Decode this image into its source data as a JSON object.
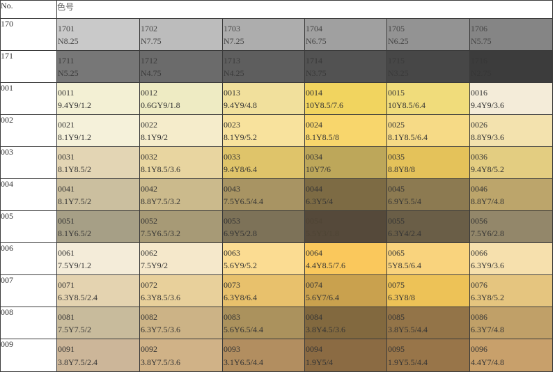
{
  "header": {
    "no_label": "No.",
    "title": "色号"
  },
  "rows": [
    {
      "no": "170",
      "cells": [
        {
          "code": "1701",
          "munsell": "N8.25",
          "color": "#c9c9c9",
          "text": "#444444"
        },
        {
          "code": "1702",
          "munsell": "N7.75",
          "color": "#bcbcbc",
          "text": "#444444"
        },
        {
          "code": "1703",
          "munsell": "N7.25",
          "color": "#adadad",
          "text": "#444444"
        },
        {
          "code": "1704",
          "munsell": "N6.75",
          "color": "#a0a0a0",
          "text": "#444444"
        },
        {
          "code": "1705",
          "munsell": "N6.25",
          "color": "#939393",
          "text": "#444444"
        },
        {
          "code": "1706",
          "munsell": "N5.75",
          "color": "#858585",
          "text": "#444444"
        }
      ]
    },
    {
      "no": "171",
      "cells": [
        {
          "code": "1711",
          "munsell": "N5.25",
          "color": "#777777",
          "text": "#3a3a3a"
        },
        {
          "code": "1712",
          "munsell": "N4.75",
          "color": "#6b6b6b",
          "text": "#3a3a3a"
        },
        {
          "code": "1713",
          "munsell": "N4.25",
          "color": "#5e5e5e",
          "text": "#3a3a3a"
        },
        {
          "code": "1714",
          "munsell": "N3.75",
          "color": "#525252",
          "text": "#383838"
        },
        {
          "code": "1715",
          "munsell": "N3.25",
          "color": "#474747",
          "text": "#3a3a3a"
        },
        {
          "code": "1716",
          "munsell": "N2.75",
          "color": "#3c3c3c",
          "text": "#363636"
        }
      ]
    },
    {
      "no": "001",
      "cells": [
        {
          "code": "0011",
          "munsell": "9.4Y9/1.2",
          "color": "#f3f0d4",
          "text": "#333333"
        },
        {
          "code": "0012",
          "munsell": "0.6GY9/1.8",
          "color": "#eeebc3",
          "text": "#333333"
        },
        {
          "code": "0013",
          "munsell": "9.4Y9/4.8",
          "color": "#f1e09c",
          "text": "#333333"
        },
        {
          "code": "0014",
          "munsell": "10Y8.5/7.6",
          "color": "#f1d45f",
          "text": "#333333"
        },
        {
          "code": "0015",
          "munsell": "10Y8.5/6.4",
          "color": "#f0dc7b",
          "text": "#333333"
        },
        {
          "code": "0016",
          "munsell": "9.4Y9/3.6",
          "color": "#f4ecd9",
          "text": "#333333"
        }
      ]
    },
    {
      "no": "002",
      "cells": [
        {
          "code": "0021",
          "munsell": "8.1Y9/1.2",
          "color": "#f5f1da",
          "text": "#333333"
        },
        {
          "code": "0022",
          "munsell": "8.1Y9/2",
          "color": "#f5eccb",
          "text": "#333333"
        },
        {
          "code": "0023",
          "munsell": "8.1Y9/5.2",
          "color": "#f8e29d",
          "text": "#333333"
        },
        {
          "code": "0024",
          "munsell": "8.1Y8.5/8",
          "color": "#f8d66c",
          "text": "#333333"
        },
        {
          "code": "0025",
          "munsell": "8.1Y8.5/6.4",
          "color": "#f6da86",
          "text": "#333333"
        },
        {
          "code": "0026",
          "munsell": "8.8Y9/3.6",
          "color": "#f3e2ae",
          "text": "#333333"
        }
      ]
    },
    {
      "no": "003",
      "cells": [
        {
          "code": "0031",
          "munsell": "8.1Y8.5/2",
          "color": "#e3d5b4",
          "text": "#333333"
        },
        {
          "code": "0032",
          "munsell": "8.1Y8.5/3.6",
          "color": "#e8d5a0",
          "text": "#333333"
        },
        {
          "code": "0033",
          "munsell": "9.4Y8/6.4",
          "color": "#dfc46a",
          "text": "#333333"
        },
        {
          "code": "0034",
          "munsell": "10Y7/6",
          "color": "#bda75a",
          "text": "#333333"
        },
        {
          "code": "0035",
          "munsell": "8.8Y8/8",
          "color": "#e4c25a",
          "text": "#333333"
        },
        {
          "code": "0036",
          "munsell": "9.4Y8/5.2",
          "color": "#e3cd81",
          "text": "#333333"
        }
      ]
    },
    {
      "no": "004",
      "cells": [
        {
          "code": "0041",
          "munsell": "8.1Y7.5/2",
          "color": "#cbbf9f",
          "text": "#333333"
        },
        {
          "code": "0042",
          "munsell": "8.8Y7.5/3.2",
          "color": "#cbba8c",
          "text": "#333333"
        },
        {
          "code": "0043",
          "munsell": "7.5Y6.5/4.4",
          "color": "#a89463",
          "text": "#333333"
        },
        {
          "code": "0044",
          "munsell": "6.3Y5/4",
          "color": "#7d6b44",
          "text": "#333333"
        },
        {
          "code": "0045",
          "munsell": "6.9Y5.5/4",
          "color": "#8c7a51",
          "text": "#333333"
        },
        {
          "code": "0046",
          "munsell": "8.8Y7/4.8",
          "color": "#bca56b",
          "text": "#333333"
        }
      ]
    },
    {
      "no": "005",
      "cells": [
        {
          "code": "0051",
          "munsell": "8.1Y6.5/2",
          "color": "#a69f86",
          "text": "#333333"
        },
        {
          "code": "0052",
          "munsell": "7.5Y6.5/3.2",
          "color": "#a79a76",
          "text": "#333333"
        },
        {
          "code": "0053",
          "munsell": "6.9Y5/2.8",
          "color": "#7d7258",
          "text": "#333333"
        },
        {
          "code": "0054",
          "munsell": "5.5Y3/1.8",
          "color": "#55493a",
          "text": "#4e4434"
        },
        {
          "code": "0055",
          "munsell": "6.3Y4/2.4",
          "color": "#6a5e47",
          "text": "#333333"
        },
        {
          "code": "0056",
          "munsell": "7.5Y6/2.8",
          "color": "#93876a",
          "text": "#333333"
        }
      ]
    },
    {
      "no": "006",
      "cells": [
        {
          "code": "0061",
          "munsell": "7.5Y9/1.2",
          "color": "#f4ecd9",
          "text": "#333333"
        },
        {
          "code": "0062",
          "munsell": "7.5Y9/2",
          "color": "#f5e8cb",
          "text": "#333333"
        },
        {
          "code": "0063",
          "munsell": "5.6Y9/5.2",
          "color": "#fbdc92",
          "text": "#333333"
        },
        {
          "code": "0064",
          "munsell": "4.4Y8.5/7.6",
          "color": "#fac85c",
          "text": "#333333"
        },
        {
          "code": "0065",
          "munsell": "5Y8.5/6.4",
          "color": "#f9d37d",
          "text": "#333333"
        },
        {
          "code": "0066",
          "munsell": "6.3Y9/3.6",
          "color": "#f6e0ad",
          "text": "#333333"
        }
      ]
    },
    {
      "no": "007",
      "cells": [
        {
          "code": "0071",
          "munsell": "6.3Y8.5/2.4",
          "color": "#e4d3b0",
          "text": "#333333"
        },
        {
          "code": "0072",
          "munsell": "6.3Y8.5/3.6",
          "color": "#e8d09b",
          "text": "#333333"
        },
        {
          "code": "0073",
          "munsell": "6.3Y8/6.4",
          "color": "#e8c16c",
          "text": "#333333"
        },
        {
          "code": "0074",
          "munsell": "5.6Y7/6.4",
          "color": "#c9a14e",
          "text": "#333333"
        },
        {
          "code": "0075",
          "munsell": "6.3Y8/8",
          "color": "#edc257",
          "text": "#333333"
        },
        {
          "code": "0076",
          "munsell": "6.3Y8/5.2",
          "color": "#e5c57f",
          "text": "#333333"
        }
      ]
    },
    {
      "no": "008",
      "cells": [
        {
          "code": "0081",
          "munsell": "7.5Y7.5/2",
          "color": "#c8bb9c",
          "text": "#333333"
        },
        {
          "code": "0082",
          "munsell": "6.3Y7.5/3.6",
          "color": "#ccb386",
          "text": "#333333"
        },
        {
          "code": "0083",
          "munsell": "5.6Y6.5/4.4",
          "color": "#ab925d",
          "text": "#333333"
        },
        {
          "code": "0084",
          "munsell": "3.8Y4.5/3.6",
          "color": "#82693f",
          "text": "#333333"
        },
        {
          "code": "0085",
          "munsell": "3.8Y5.5/4.4",
          "color": "#937448",
          "text": "#333333"
        },
        {
          "code": "0086",
          "munsell": "6.3Y7/4.8",
          "color": "#c0a068",
          "text": "#333333"
        }
      ]
    },
    {
      "no": "009",
      "cells": [
        {
          "code": "0091",
          "munsell": "3.8Y7.5/2.4",
          "color": "#ccb699",
          "text": "#333333"
        },
        {
          "code": "0092",
          "munsell": "3.8Y7.5/3.6",
          "color": "#d0b287",
          "text": "#333333"
        },
        {
          "code": "0093",
          "munsell": "3.1Y6.5/4.4",
          "color": "#b28e60",
          "text": "#333333"
        },
        {
          "code": "0094",
          "munsell": "1.9Y5/4",
          "color": "#8b6b43",
          "text": "#333333"
        },
        {
          "code": "0095",
          "munsell": "1.9Y5.5/4.4",
          "color": "#987549",
          "text": "#333333"
        },
        {
          "code": "0096",
          "munsell": "4.4Y7/4.8",
          "color": "#c8a06b",
          "text": "#333333"
        }
      ]
    }
  ]
}
